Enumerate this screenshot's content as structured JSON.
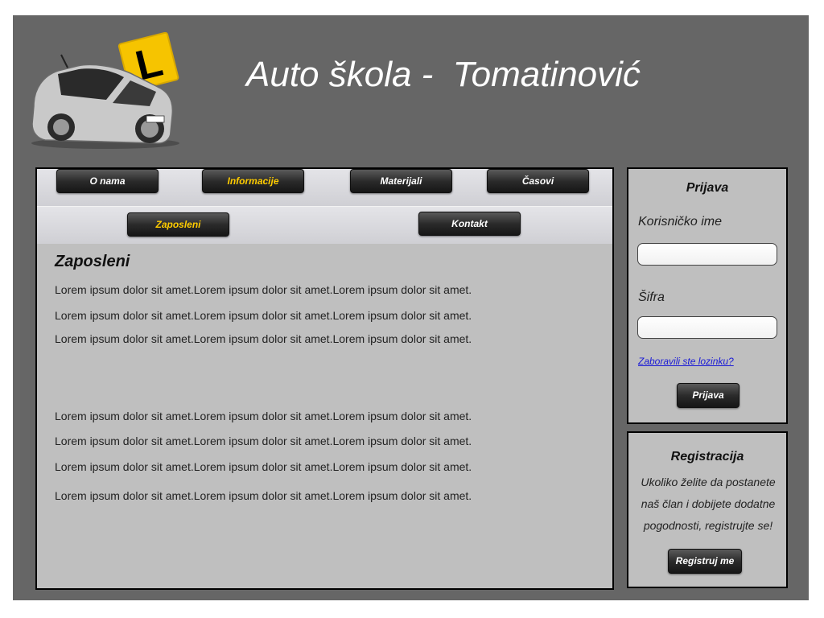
{
  "header": {
    "title": "Auto škola -  Tomatinović",
    "logo_letter": "L"
  },
  "nav": {
    "row1": [
      {
        "label": "O nama",
        "active": false
      },
      {
        "label": "Informacije",
        "active": true
      },
      {
        "label": "Materijali",
        "active": false
      },
      {
        "label": "Časovi",
        "active": false
      }
    ],
    "row2": [
      {
        "label": "Zaposleni",
        "active": true
      },
      {
        "label": "Kontakt",
        "active": false
      }
    ]
  },
  "content": {
    "title": "Zaposleni",
    "paragraphs": [
      "Lorem ipsum dolor sit amet.Lorem ipsum dolor sit amet.Lorem ipsum dolor sit amet.",
      "Lorem ipsum dolor sit amet.Lorem ipsum dolor sit amet.Lorem ipsum dolor sit amet.",
      "Lorem ipsum dolor sit amet.Lorem ipsum dolor sit amet.Lorem ipsum dolor sit amet.",
      "Lorem ipsum dolor sit amet.Lorem ipsum dolor sit amet.Lorem ipsum dolor sit amet.",
      "Lorem ipsum dolor sit amet.Lorem ipsum dolor sit amet.Lorem ipsum dolor sit amet.",
      "Lorem ipsum dolor sit amet.Lorem ipsum dolor sit amet.Lorem ipsum dolor sit amet.",
      "Lorem ipsum dolor sit amet.Lorem ipsum dolor sit amet.Lorem ipsum dolor sit amet."
    ]
  },
  "login": {
    "title": "Prijava",
    "username_label": "Korisničko ime",
    "username_value": "",
    "password_label": "Šifra",
    "password_value": "",
    "forgot_link": "Zaboravili ste lozinku?",
    "submit_label": "Prijava"
  },
  "register": {
    "title": "Registracija",
    "text": "Ukoliko želite da postanete naš član i dobijete dodatne pogodnosti, registrujte se!",
    "button_label": "Registruj me"
  },
  "colors": {
    "background": "#666666",
    "panel": "#bfbfbf",
    "active_nav": "#ffcc00",
    "link": "#1a1ad6"
  }
}
